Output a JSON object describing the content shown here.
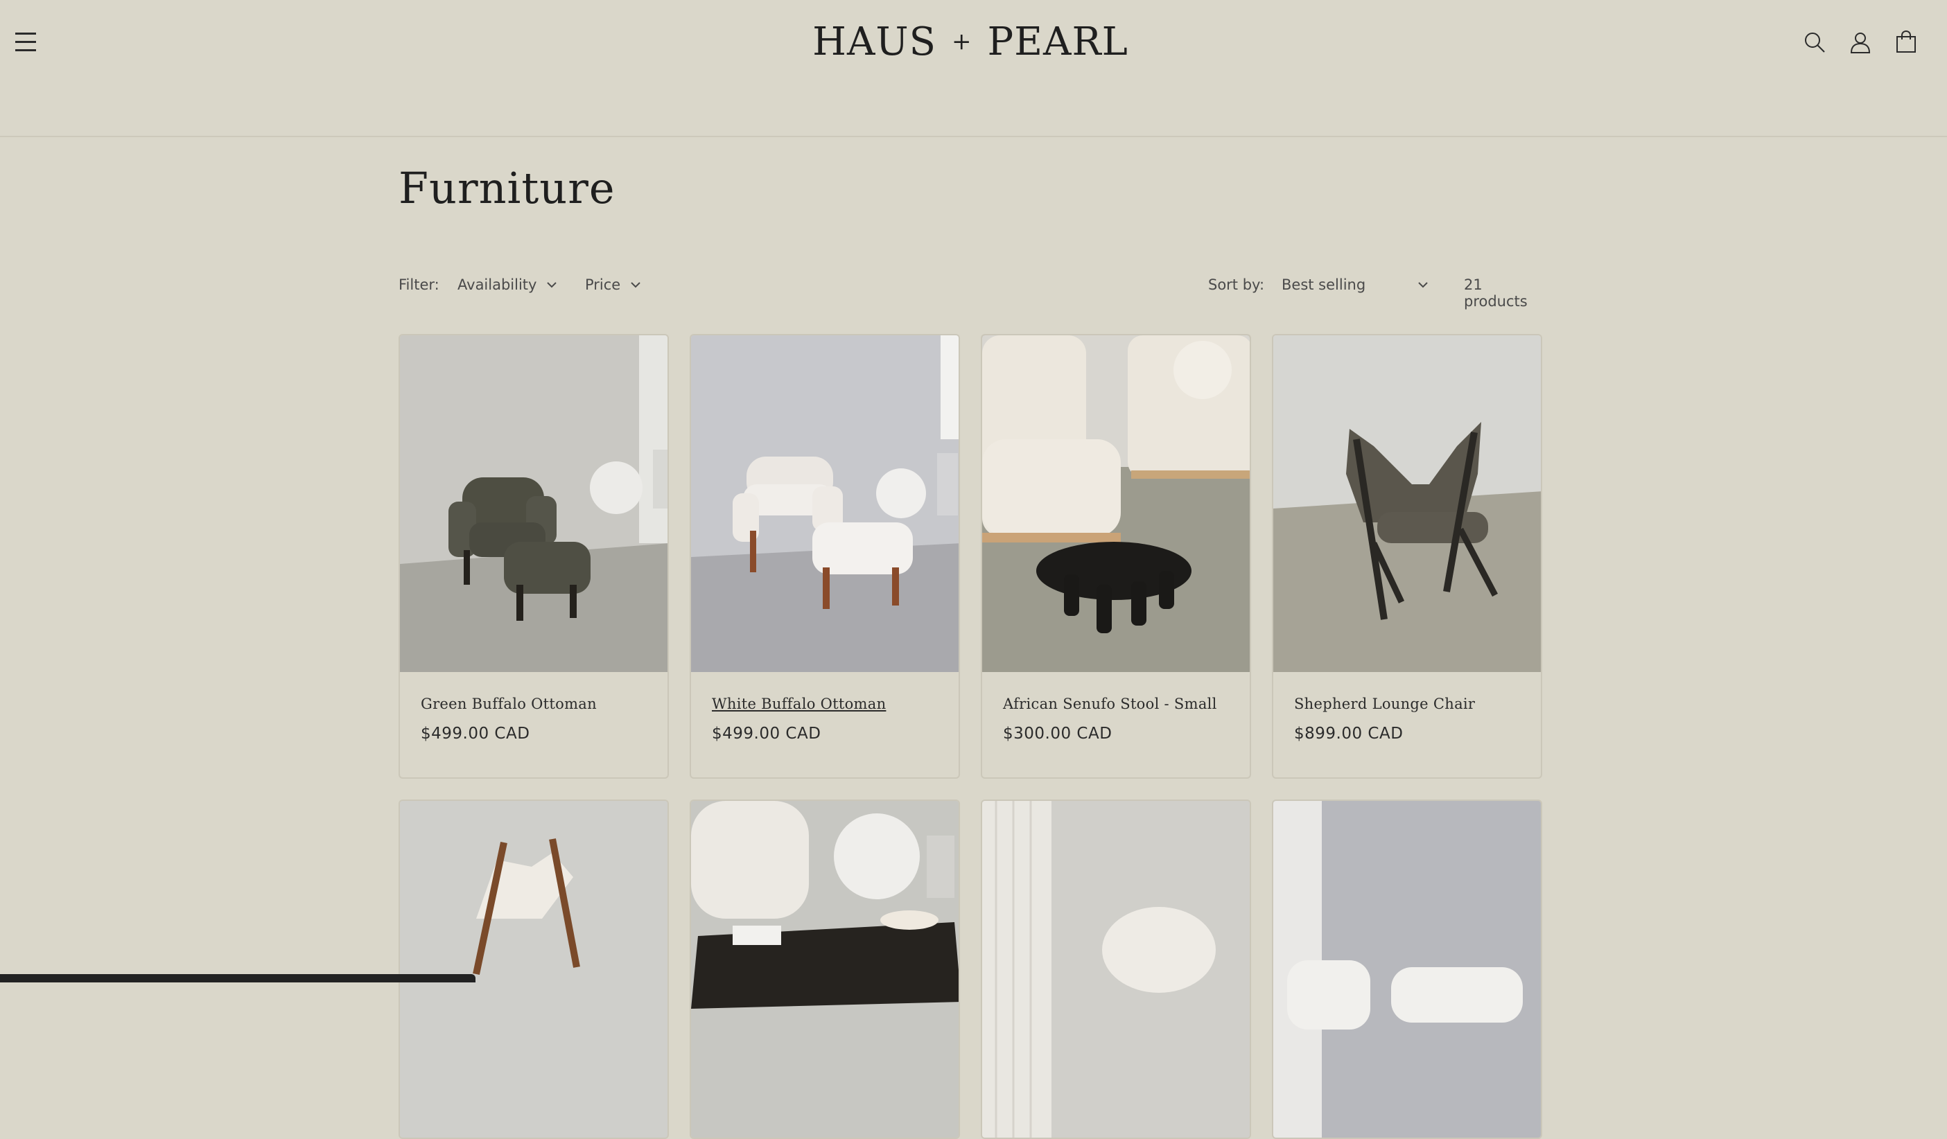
{
  "header": {
    "brand_left": "HAUS",
    "brand_plus": "+",
    "brand_right": "PEARL",
    "icons": [
      "menu-icon",
      "search-icon",
      "account-icon",
      "cart-icon"
    ]
  },
  "collection": {
    "title": "Furniture"
  },
  "toolbar": {
    "filter_label": "Filter:",
    "filters": [
      "Availability",
      "Price"
    ],
    "sort_label": "Sort by:",
    "sort_value": "Best selling",
    "count": "21 products"
  },
  "products": [
    {
      "name": "Green Buffalo Ottoman",
      "price": "$499.00 CAD"
    },
    {
      "name": "White Buffalo Ottoman",
      "price": "$499.00 CAD"
    },
    {
      "name": "African Senufo Stool - Small",
      "price": "$300.00 CAD"
    },
    {
      "name": "Shepherd Lounge Chair",
      "price": "$899.00 CAD"
    }
  ],
  "colors": {
    "background": "#dad7ca",
    "text": "#2b2b2b",
    "border": "#cbc7b9"
  }
}
